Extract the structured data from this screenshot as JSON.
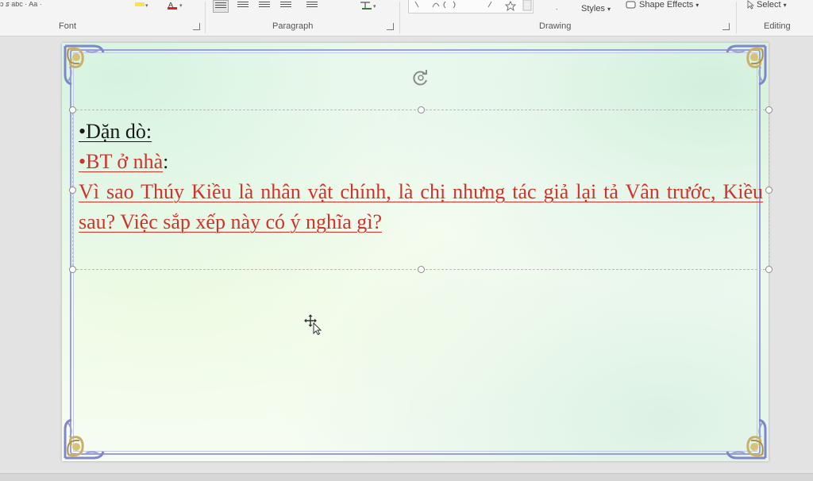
{
  "ribbon": {
    "groups": {
      "font": "Font",
      "paragraph": "Paragraph",
      "drawing": "Drawing",
      "editing": "Editing"
    },
    "buttons": {
      "styles": "Styles",
      "shape_effects": "Shape Effects",
      "select": "Select"
    }
  },
  "slide": {
    "line1": "•Dặn dò:",
    "line2_bullet": "•BT ở nhà",
    "line2_colon": ":",
    "paragraph": "Vì sao Thúy Kiều là nhân vật chính, là chị nhưng tác giả lại tả Vân trước, Kiều sau? Việc sắp xếp này có ý nghĩa gì?"
  },
  "colors": {
    "text_red": "#d1332b",
    "frame_purple": "#9aa0d4"
  }
}
